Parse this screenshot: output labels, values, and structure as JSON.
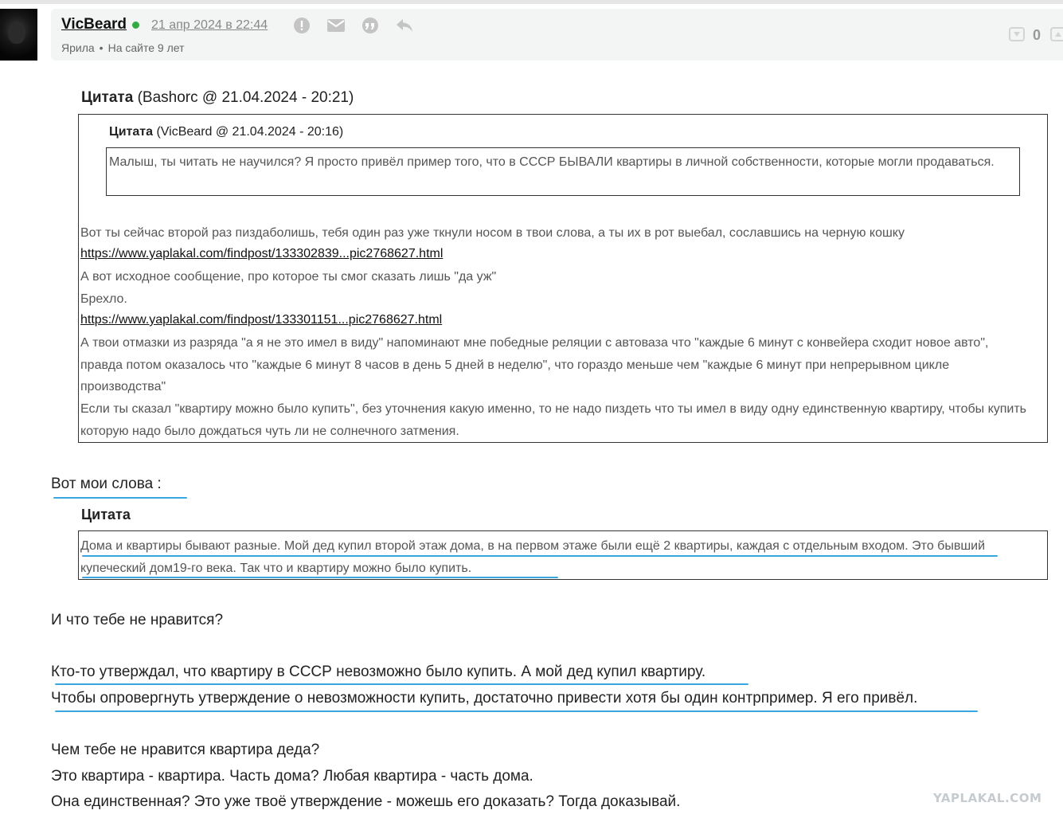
{
  "post": {
    "username": "VicBeard",
    "date": "21 апр 2024 в 22:44",
    "rank": "Ярила",
    "bullet": "•",
    "tenure": "На сайте 9 лет",
    "rating": "0",
    "online_color": "#33aa44"
  },
  "quote_outer": {
    "label": "Цитата",
    "source": "(Bashorc @ 21.04.2024 - 20:21)",
    "inner": {
      "label": "Цитата",
      "source": "(VicBeard @ 21.04.2024 - 20:16)",
      "text": "Малыш, ты читать не научился? Я просто привёл пример того, что в СССР БЫВАЛИ квартиры в личной собственности, которые могли продаваться."
    },
    "line1": "Вот ты сейчас второй раз пиздаболишь, тебя один раз уже ткнули носом в твои слова, а ты их в рот выебал, сославшись на черную кошку",
    "link1": "https://www.yaplakal.com/findpost/133302839...pic2768627.html",
    "line2": "А вот исходное сообщение, про которое ты смог сказать лишь \"да уж\"",
    "line3": "Брехло.",
    "link2": "https://www.yaplakal.com/findpost/133301151...pic2768627.html",
    "para1": "А твои отмазки из разряда \"а я не это имел в виду\" напоминают мне победные реляции с автоваза что \"каждые 6 минут с конвейера сходит новое авто\", правда потом оказалось что \"каждые 6 минут 8 часов в день 5 дней в неделю\", что гораздо меньше чем \"каждые 6 минут при непрерывном цикле производства\"",
    "para2": "Если ты сказал \"квартиру можно было купить\", без уточнения какую именно, то не надо пиздеть что ты имел в виду одну единственную квартиру, чтобы купить которую надо было дождаться чуть ли не солнечного затмения."
  },
  "body": {
    "my_words": "Вот мои слова :",
    "quote2_label": "Цитата",
    "quote2_text": "Дома и квартиры бывают разные. Мой дед купил второй этаж дома, в на первом этаже были ещё 2 квартиры, каждая с отдельным входом. Это бывший купеческий дом19-го века. Так что и квартиру можно было купить.",
    "q1": "И что тебе не нравится?",
    "l1": "Кто-то утверждал, что квартиру в СССР невозможно было купить. А мой дед купил квартиру.",
    "l2": "Чтобы опровергнуть утверждение о невозможности купить, достаточно привести хотя бы один контрпример. Я его привёл.",
    "l3": "Чем тебе не нравится квартира деда?",
    "l4": "Это квартира - квартира. Часть дома? Любая квартира - часть дома.",
    "l5": "Она единственная? Это уже твоё утверждение - можешь его доказать? Тогда доказывай.",
    "underline_color": "#3aa6e0"
  },
  "watermark": "YAPLAKAL.COM"
}
